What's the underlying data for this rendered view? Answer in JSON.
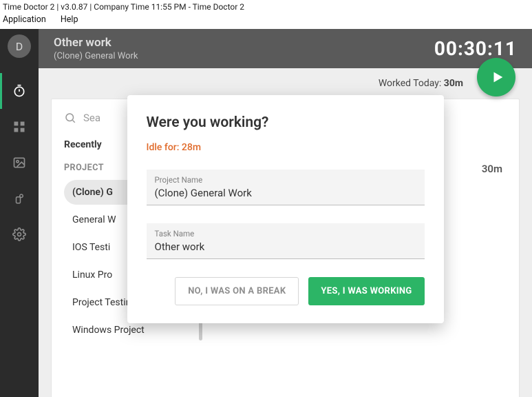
{
  "window": {
    "title": "Time Doctor 2 | v3.0.87 | Company Time 11:55 PM - Time Doctor 2",
    "menu": {
      "application": "Application",
      "help": "Help"
    }
  },
  "avatar_initial": "D",
  "header": {
    "task_title": "Other work",
    "project": "(Clone) General Work",
    "timer": "00:30:11"
  },
  "worked_today": {
    "label": "Worked Today: ",
    "value": "30m"
  },
  "search": {
    "placeholder": "Sea"
  },
  "sections": {
    "recently": "Recently",
    "projects_label": "PROJECT"
  },
  "projects": [
    {
      "name": "(Clone) G",
      "selected": true
    },
    {
      "name": "General W"
    },
    {
      "name": "IOS Testi"
    },
    {
      "name": "Linux Pro"
    },
    {
      "name": "Project Testing"
    },
    {
      "name": "Windows Project"
    }
  ],
  "right_list": {
    "duration": "30m"
  },
  "modal": {
    "title": "Were you working?",
    "idle_text": "Idle for: 28m",
    "project_label": "Project Name",
    "project_value": "(Clone) General Work",
    "task_label": "Task Name",
    "task_value": "Other work",
    "break_btn": "NO, I WAS ON A BREAK",
    "working_btn": "YES, I WAS WORKING"
  },
  "colors": {
    "accent": "#2cb566",
    "warn": "#e06a2a"
  }
}
